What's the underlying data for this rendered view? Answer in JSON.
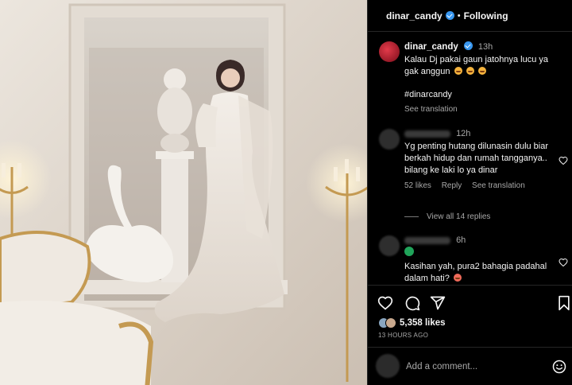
{
  "header": {
    "username": "dinar_candy",
    "separator": "•",
    "follow_label": "Following"
  },
  "caption": {
    "username": "dinar_candy",
    "time": "13h",
    "text": "Kalau Dj pakai gaun jatohnya lucu ya gak anggun",
    "hashtag": "#dinarcandy",
    "see_translation": "See translation"
  },
  "comments": [
    {
      "time": "12h",
      "text": "Yg penting hutang dilunasin dulu biar berkah hidup dan rumah tangganya.. bilang ke laki lo ya dinar",
      "likes": "52 likes",
      "reply": "Reply",
      "see_translation": "See translation",
      "view_replies": "View all 14 replies"
    },
    {
      "time": "6h",
      "text": "Kasihan yah, pura2 bahagia padahal dalam hati?"
    }
  ],
  "post": {
    "likes": "5,358 likes",
    "timestamp": "13 HOURS AGO"
  },
  "add_comment": {
    "placeholder": "Add a comment..."
  },
  "icons": {
    "verified": "verified-badge-icon",
    "heart": "heart-icon",
    "comment": "comment-bubble-icon",
    "share": "paper-plane-icon",
    "save": "bookmark-icon",
    "emoji": "smiley-icon"
  },
  "colors": {
    "background": "#000000",
    "text": "#f5f5f5",
    "muted": "#a8a8a8",
    "verified": "#3897f0",
    "divider": "#262626"
  }
}
